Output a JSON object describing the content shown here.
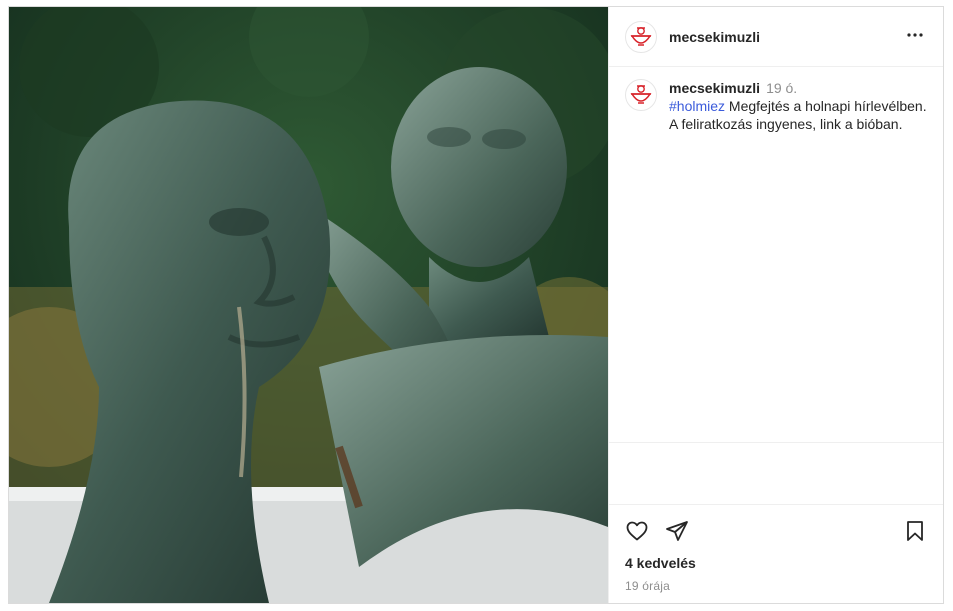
{
  "post": {
    "image_alt": "Bronze fountain statue of two figures",
    "account": {
      "username": "mecsekimuzli"
    },
    "more_icon": "more-horizontal-icon",
    "caption": {
      "username": "mecsekimuzli",
      "time": "19 ó.",
      "hashtag": "#holmiez",
      "text": " Megfejtés a holnapi hírlevélben. A feliratkozás ingyenes, link a bióban."
    },
    "actions": {
      "like_icon": "heart-icon",
      "share_icon": "send-icon",
      "save_icon": "bookmark-icon"
    },
    "likes": "4 kedvelés",
    "ago": "19 órája"
  },
  "colors": {
    "link": "#3b5bdb",
    "muted": "#8e8e8e",
    "text": "#262626",
    "border": "#dbdbdb",
    "logo_red": "#d8232a"
  }
}
